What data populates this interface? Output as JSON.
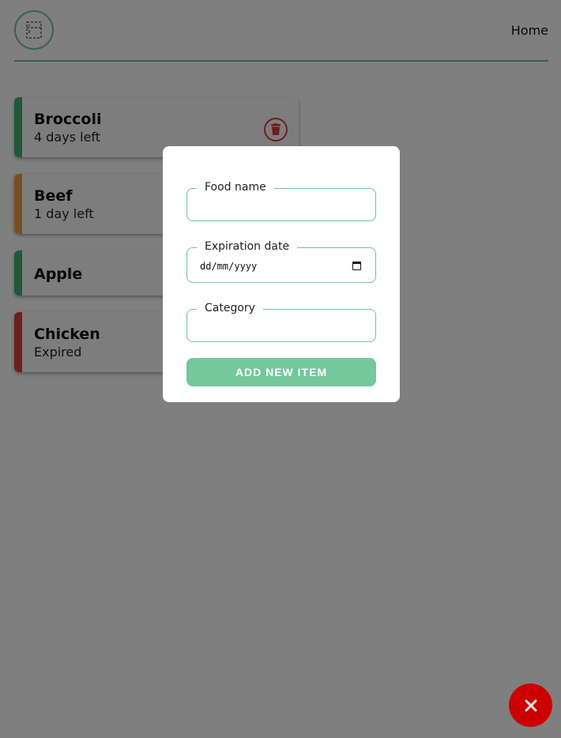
{
  "header": {
    "logo_icon": "fridge-icon",
    "nav_home": "Home"
  },
  "items": [
    {
      "name": "Broccoli",
      "status": "4 days left",
      "color": "#3cb371"
    },
    {
      "name": "Beef",
      "status": "1 day left",
      "color": "#f0a040"
    },
    {
      "name": "Apple",
      "status": "",
      "color": "#3cb371"
    },
    {
      "name": "Chicken",
      "status": "Expired",
      "color": "#e03a3a"
    }
  ],
  "card_icons": {
    "delete": "trash-icon"
  },
  "modal": {
    "food_name_label": "Food name",
    "food_name_value": "",
    "expiration_label": "Expiration date",
    "expiration_value": "dd/mm/yyyy",
    "category_label": "Category",
    "category_value": "",
    "add_button": "ADD NEW ITEM"
  },
  "fab": {
    "icon": "close-icon"
  },
  "colors": {
    "accent": "#6fc39a",
    "button": "#75c79c",
    "danger": "#e03a3a",
    "fab": "#cc0000"
  }
}
